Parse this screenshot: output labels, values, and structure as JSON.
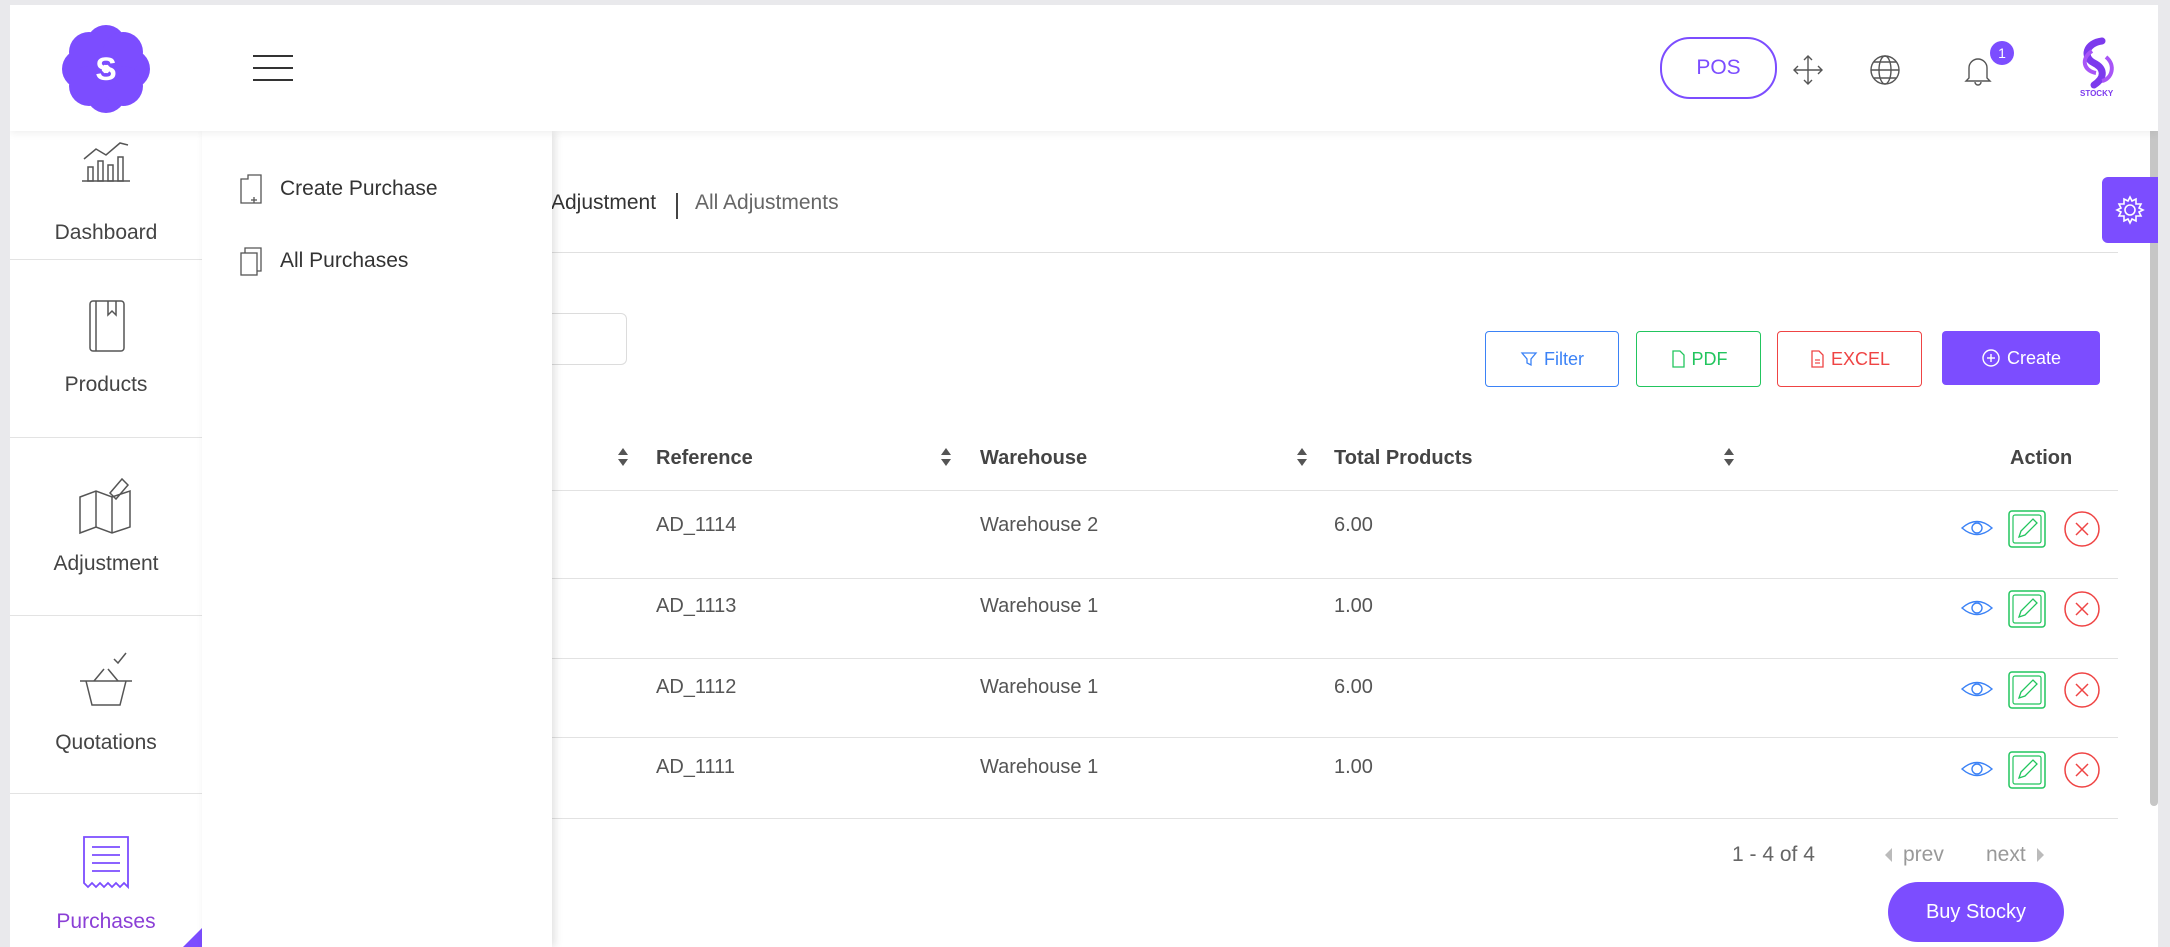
{
  "header": {
    "logo_letter": "S",
    "pos_label": "POS",
    "notification_count": "1",
    "brand_text": "STOCKY",
    "accent_color": "#7c4dff"
  },
  "sidebar": {
    "items": [
      {
        "label": "Dashboard",
        "icon": "chart-icon"
      },
      {
        "label": "Products",
        "icon": "book-icon"
      },
      {
        "label": "Adjustment",
        "icon": "map-edit-icon"
      },
      {
        "label": "Quotations",
        "icon": "basket-icon"
      },
      {
        "label": "Purchases",
        "icon": "receipt-icon",
        "active": true
      }
    ]
  },
  "submenu": {
    "items": [
      {
        "label": "Create Purchase",
        "icon": "new-document-icon"
      },
      {
        "label": "All Purchases",
        "icon": "documents-icon"
      }
    ]
  },
  "breadcrumb": {
    "section": "Adjustment",
    "page": "All Adjustments"
  },
  "toolbar": {
    "filter_label": "Filter",
    "pdf_label": "PDF",
    "excel_label": "EXCEL",
    "create_label": "Create"
  },
  "table": {
    "columns": [
      "Reference",
      "Warehouse",
      "Total Products",
      "Action"
    ],
    "rows": [
      {
        "reference": "AD_1114",
        "warehouse": "Warehouse 2",
        "total_products": "6.00"
      },
      {
        "reference": "AD_1113",
        "warehouse": "Warehouse 1",
        "total_products": "1.00"
      },
      {
        "reference": "AD_1112",
        "warehouse": "Warehouse 1",
        "total_products": "6.00"
      },
      {
        "reference": "AD_1111",
        "warehouse": "Warehouse 1",
        "total_products": "1.00"
      }
    ]
  },
  "pagination": {
    "info": "1 - 4 of 4",
    "prev_label": "prev",
    "next_label": "next"
  },
  "buy_label": "Buy Stocky"
}
